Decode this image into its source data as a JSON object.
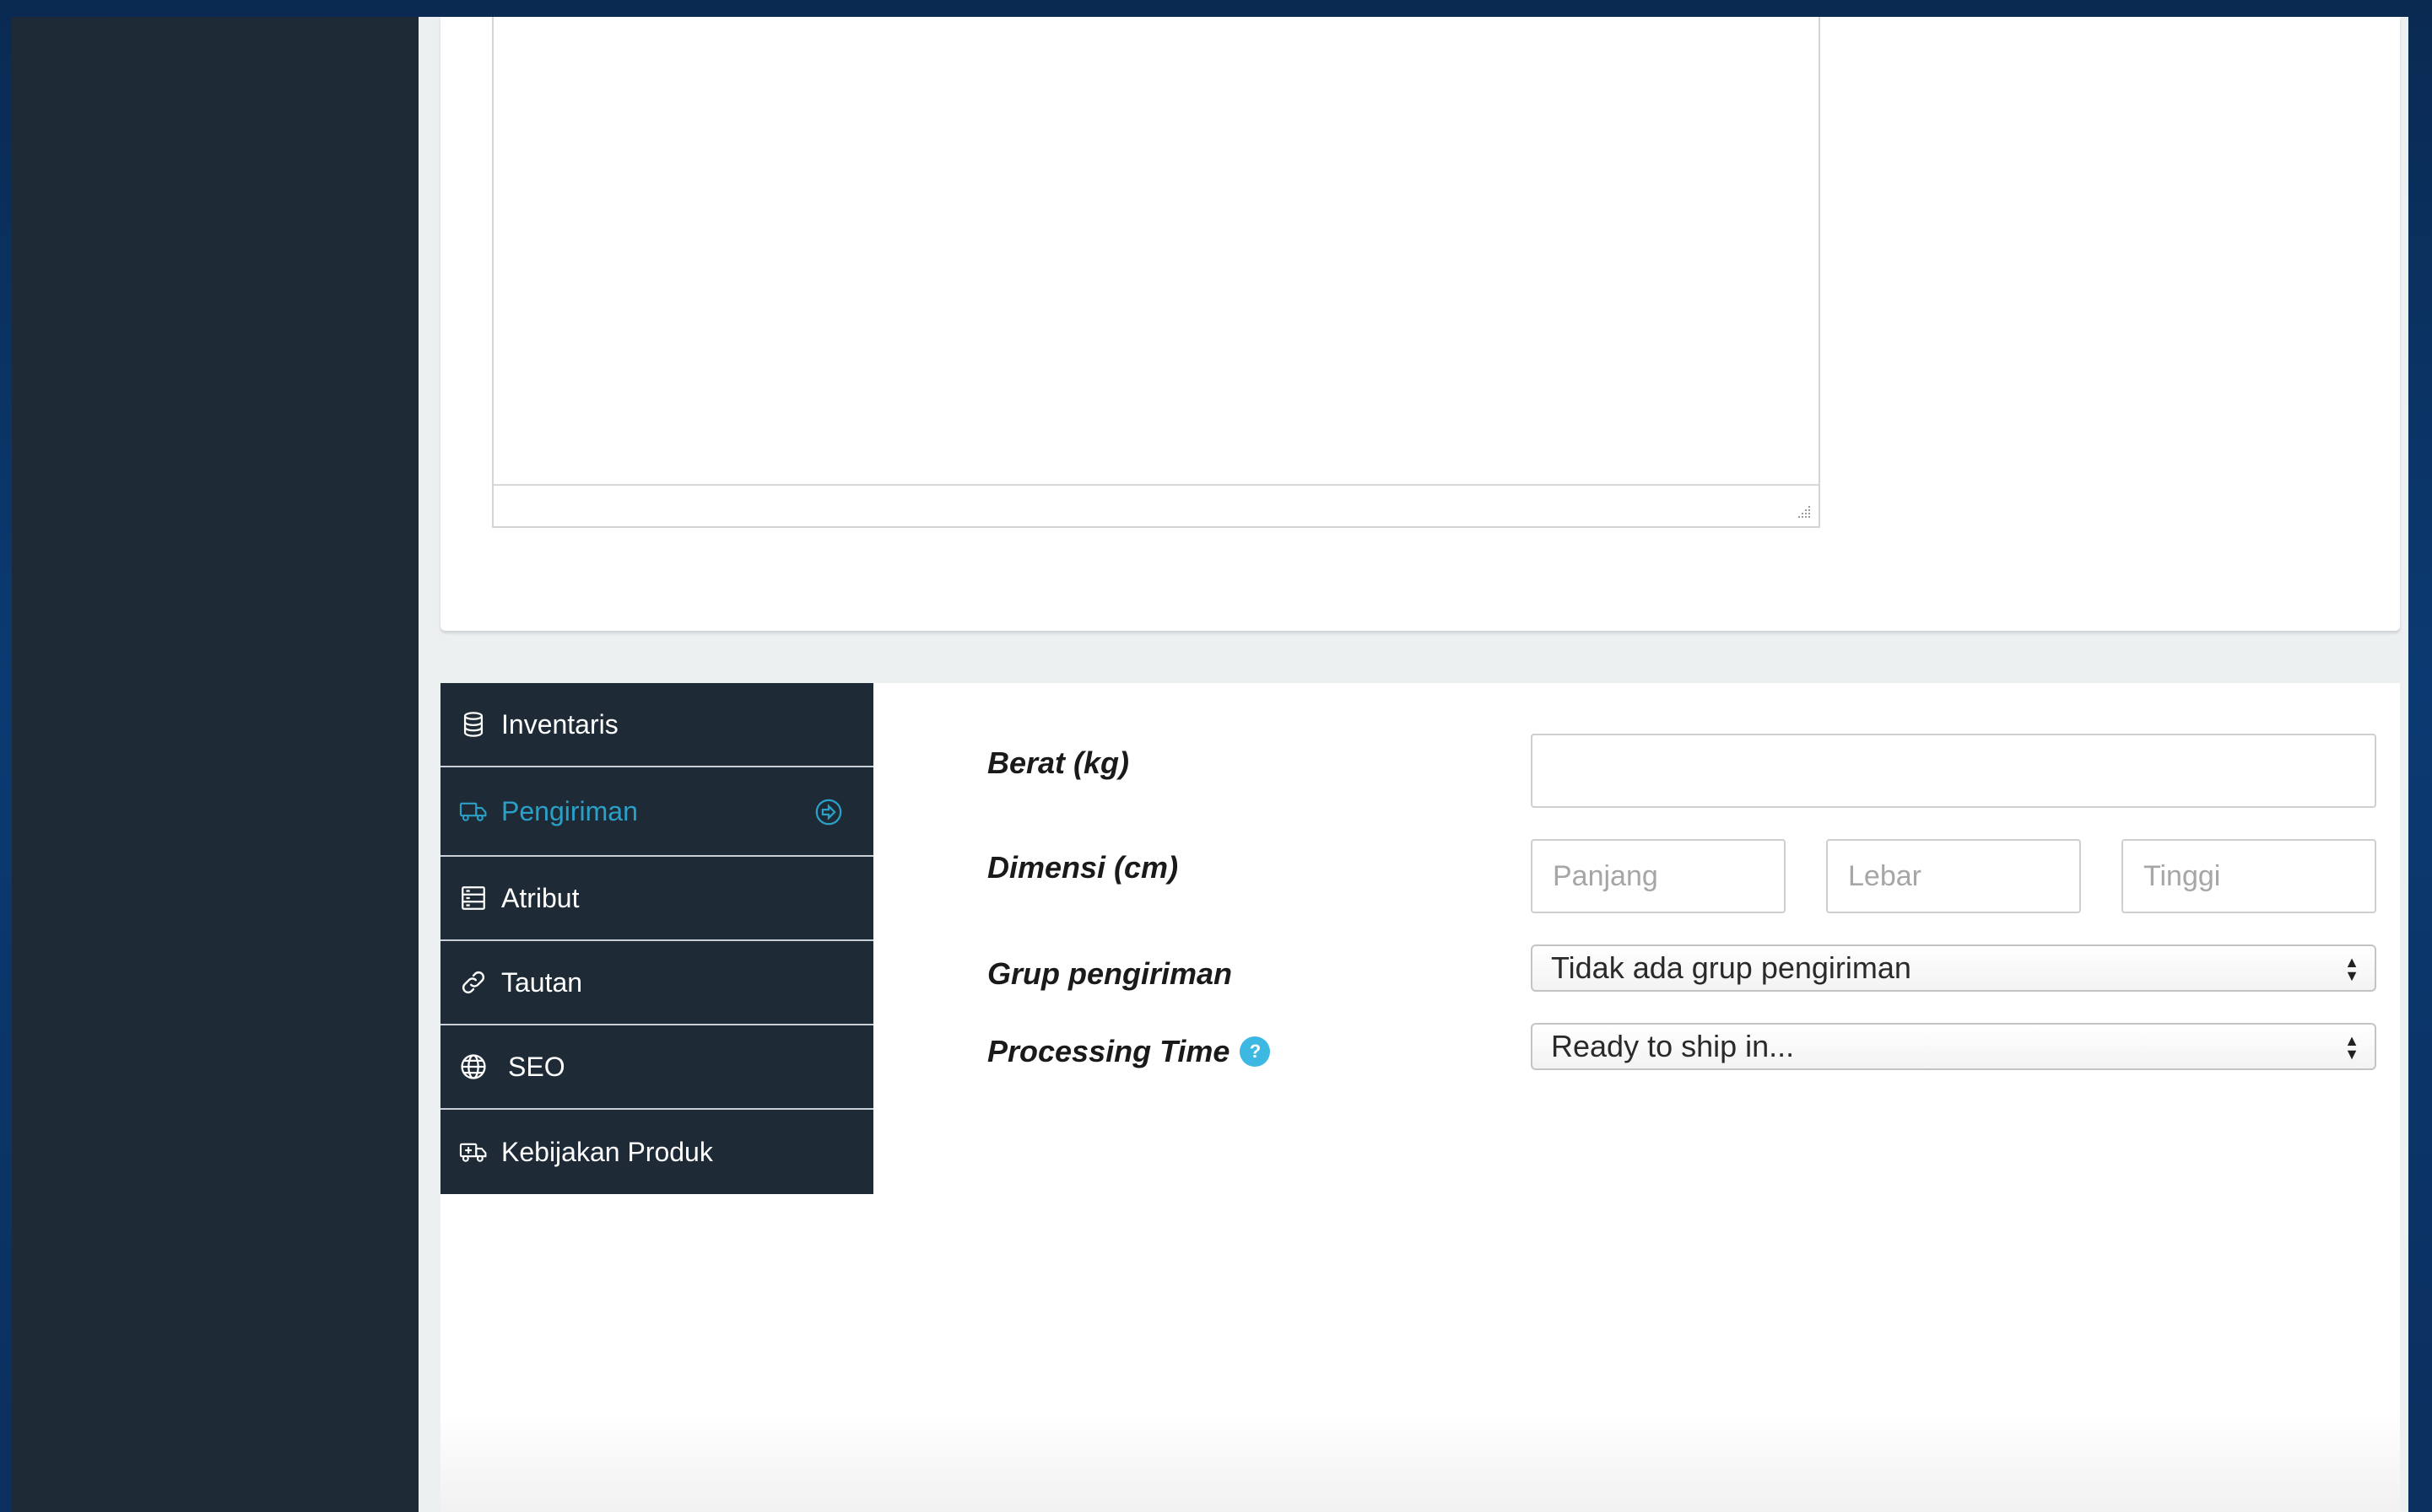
{
  "tabs": [
    {
      "label": "Inventaris",
      "icon": "database-icon"
    },
    {
      "label": "Pengiriman",
      "icon": "truck-icon",
      "active": true
    },
    {
      "label": "Atribut",
      "icon": "server-icon"
    },
    {
      "label": "Tautan",
      "icon": "link-icon"
    },
    {
      "label": "SEO",
      "icon": "globe-icon"
    },
    {
      "label": "Kebijakan Produk",
      "icon": "ambulance-icon"
    }
  ],
  "form": {
    "weight_label": "Berat (kg)",
    "weight_value": "",
    "dimension_label": "Dimensi (cm)",
    "length_placeholder": "Panjang",
    "width_placeholder": "Lebar",
    "height_placeholder": "Tinggi",
    "shipping_group_label": "Grup pengiriman",
    "shipping_group_value": "Tidak ada grup pengiriman",
    "processing_time_label": "Processing Time",
    "processing_time_value": "Ready to ship in..."
  },
  "colors": {
    "sidebar_bg": "#1e2b36",
    "active_tab": "#2aa0c9",
    "help_icon": "#3db8e3"
  }
}
